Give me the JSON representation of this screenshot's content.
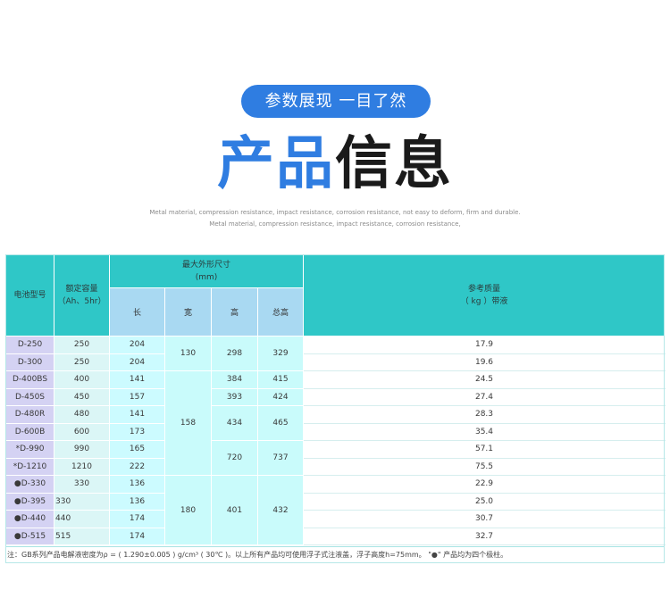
{
  "header": {
    "tagline": "参数展现 一目了然",
    "title_blue": "产品",
    "title_dark": "信息",
    "subtitle_1": "Metal material, compression resistance, impact resistance, corrosion resistance, not easy to deform, firm and durable.",
    "subtitle_2": "Metal material, compression resistance, impact resistance, corrosion resistance,"
  },
  "table": {
    "headers": {
      "model": "电池型号",
      "capacity_line1": "额定容量",
      "capacity_line2": "（Ah、5hr）",
      "dims_line1": "最大外形尺寸",
      "dims_line2": "(mm)",
      "length": "长",
      "width": "宽",
      "height": "高",
      "total_height": "总高",
      "weight_line1": "参考质量",
      "weight_line2": "（ kg ）带液"
    },
    "rows": [
      {
        "model": "D-250",
        "capacity": "250",
        "length": "204",
        "weight": "17.9"
      },
      {
        "model": "D-300",
        "capacity": "250",
        "length": "204",
        "weight": "19.6"
      },
      {
        "model": "D-400BS",
        "capacity": "400",
        "length": "141",
        "weight": "24.5"
      },
      {
        "model": "D-450S",
        "capacity": "450",
        "length": "157",
        "weight": "27.4"
      },
      {
        "model": "D-480R",
        "capacity": "480",
        "length": "141",
        "weight": "28.3"
      },
      {
        "model": "D-600B",
        "capacity": "600",
        "length": "173",
        "weight": "35.4"
      },
      {
        "model": "*D-990",
        "capacity": "990",
        "length": "165",
        "weight": "57.1"
      },
      {
        "model": "*D-1210",
        "capacity": "1210",
        "length": "222",
        "weight": "75.5"
      },
      {
        "model": "●D-330",
        "capacity": "330",
        "length": "136",
        "weight": "22.9"
      },
      {
        "model": "●D-395",
        "capacity": "330",
        "length": "136",
        "weight": "25.0"
      },
      {
        "model": "●D-440",
        "capacity": "440",
        "length": "174",
        "weight": "30.7"
      },
      {
        "model": "●D-515",
        "capacity": "515",
        "length": "174",
        "weight": "32.7"
      }
    ],
    "merged": {
      "width_a": "130",
      "width_b": "158",
      "width_c": "180",
      "height_a": "298",
      "height_b": "384",
      "height_c": "393",
      "height_d": "434",
      "height_e": "720",
      "height_f": "401",
      "total_a": "329",
      "total_b": "415",
      "total_c": "424",
      "total_d": "465",
      "total_e": "737",
      "total_f": "432"
    },
    "note": "注：GB系列产品电解液密度为ρ = ( 1.290±0.005 ) g/cm³ ( 30℃ )。以上所有产品均可使用浮子式注液盖，浮子高度h=75mm。 \"●\" 产品均为四个极柱。"
  },
  "colors": {
    "accent_blue": "#2f7de1",
    "header_teal": "#2fc7c7",
    "subheader_blue": "#a9d9f2",
    "model_lavender": "#d4d2f3",
    "dims_cyan": "#c9fbfb"
  }
}
